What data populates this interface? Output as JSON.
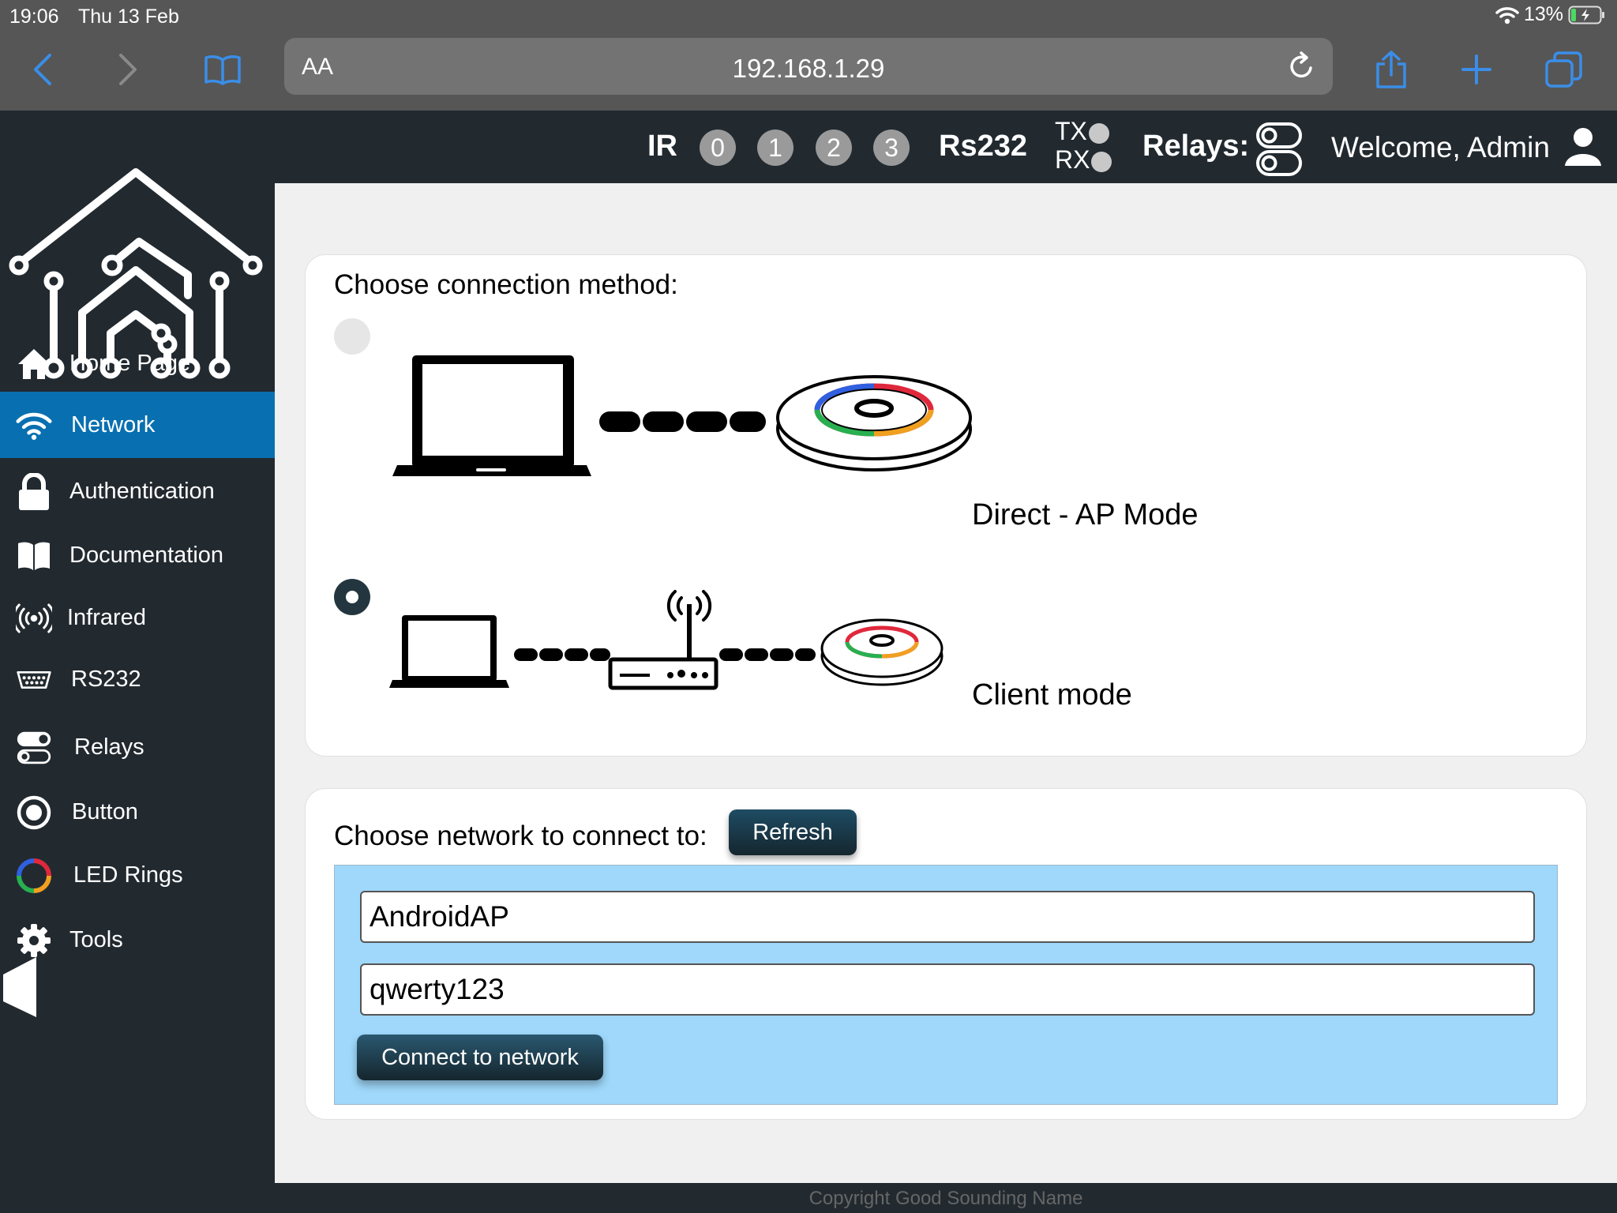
{
  "statusbar": {
    "time": "19:06",
    "date": "Thu 13 Feb",
    "battery": "13%"
  },
  "browser": {
    "text_size": "AA",
    "url": "192.168.1.29"
  },
  "header": {
    "ir_label": "IR",
    "ir_channels": [
      "0",
      "1",
      "2",
      "3"
    ],
    "rs232_label": "Rs232",
    "tx_label": "TX",
    "rx_label": "RX",
    "relays_label": "Relays:",
    "welcome": "Welcome, Admin"
  },
  "sidebar": {
    "items": [
      {
        "label": "Home Page",
        "icon": "home-icon"
      },
      {
        "label": "Network",
        "icon": "wifi-icon",
        "active": true
      },
      {
        "label": "Authentication",
        "icon": "lock-icon"
      },
      {
        "label": "Documentation",
        "icon": "book-icon"
      },
      {
        "label": "Infrared",
        "icon": "infrared-icon"
      },
      {
        "label": "RS232",
        "icon": "serial-port-icon"
      },
      {
        "label": "Relays",
        "icon": "toggle-icon"
      },
      {
        "label": "Button",
        "icon": "button-icon"
      },
      {
        "label": "LED Rings",
        "icon": "color-ring-icon"
      },
      {
        "label": "Tools",
        "icon": "gear-icon"
      }
    ]
  },
  "connection": {
    "title": "Choose connection method:",
    "options": [
      {
        "label": "Direct - AP Mode",
        "selected": false
      },
      {
        "label": "Client mode",
        "selected": true
      }
    ]
  },
  "network": {
    "title": "Choose network to connect to:",
    "refresh_label": "Refresh",
    "ssid_value": "AndroidAP",
    "password_value": "qwerty123",
    "connect_label": "Connect to network"
  },
  "footer": {
    "text": "Copyright Good Sounding Name"
  },
  "colors": {
    "accent": "#0870b0",
    "sidebar": "#222a30",
    "panel": "#9fd8fa",
    "browser_chrome": "#565656",
    "ios_blue": "#3a8ee8"
  }
}
